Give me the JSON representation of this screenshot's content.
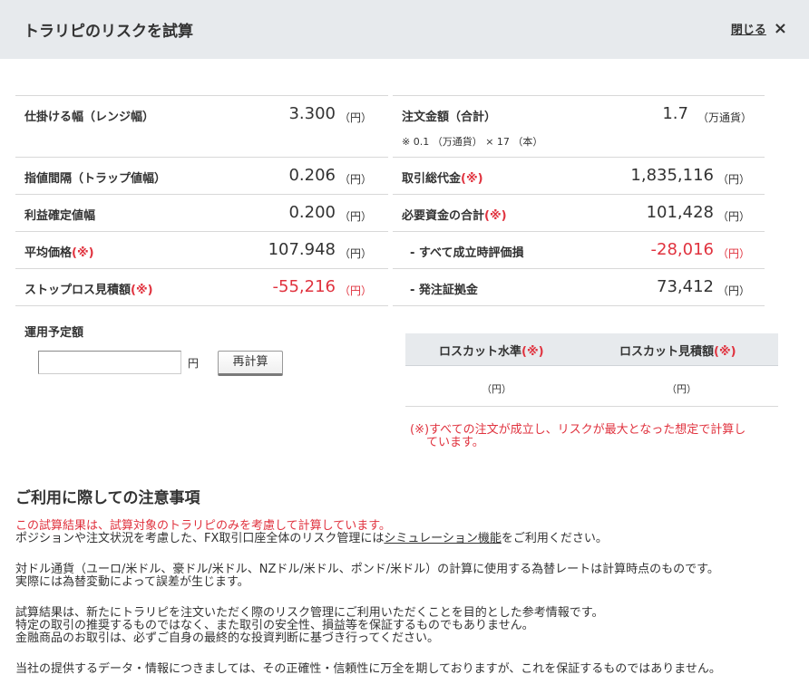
{
  "header": {
    "title": "トラリピのリスクを試算",
    "close_label": "閉じる",
    "close_icon": "×"
  },
  "left_rows": [
    {
      "label": "仕掛ける幅（レンジ幅）",
      "value": "3.300",
      "unit": "（円）"
    },
    {
      "label": "指値間隔（トラップ値幅）",
      "value": "0.206",
      "unit": "（円）"
    },
    {
      "label": "利益確定値幅",
      "value": "0.200",
      "unit": "（円）"
    },
    {
      "label": "平均価格",
      "mark": "(※)",
      "value": "107.948",
      "unit": "（円）"
    },
    {
      "label": "ストップロス見積額",
      "mark": "(※)",
      "value": "-55,216",
      "unit": "（円）"
    }
  ],
  "right_rows": [
    {
      "label": "注文金額（合計）",
      "value": "1.7",
      "unit": "（万通貨）",
      "sub": "※ 0.1 （万通貨） × 17 （本）"
    },
    {
      "label": "取引総代金",
      "mark": "(※)",
      "value": "1,835,116",
      "unit": "（円）"
    },
    {
      "label": "必要資金の合計",
      "mark": "(※)",
      "value": "101,428",
      "unit": "（円）"
    },
    {
      "label": "- すべて成立時評価損",
      "value": "-28,016",
      "unit": "（円）"
    },
    {
      "label": "- 発注証拠金",
      "value": "73,412",
      "unit": "（円）"
    }
  ],
  "plan": {
    "label": "運用予定額",
    "input_value": "",
    "unit": "円",
    "button": "再計算"
  },
  "losscut": {
    "col1": "ロスカット水準",
    "col2": "ロスカット見積額",
    "mark": "(※)",
    "unit1": "（円）",
    "unit2": "（円）"
  },
  "risk_note": {
    "line1": "(※)すべての注文が成立し、リスクが最大となった想定で計算し",
    "line2": "ています。"
  },
  "notes": {
    "title": "ご利用に際しての注意事項",
    "red_line": "この試算結果は、試算対象のトラリピのみを考慮して計算しています。",
    "p1_before": "ポジションや注文状況を考慮した、FX取引口座全体のリスク管理には",
    "p1_link": "シミュレーション機能",
    "p1_after": "をご利用ください。",
    "p2_l1": "対ドル通貨（ユーロ/米ドル、豪ドル/米ドル、NZドル/米ドル、ポンド/米ドル）の計算に使用する為替レートは計算時点のものです。",
    "p2_l2": "実際には為替変動によって誤差が生じます。",
    "p3_l1": "試算結果は、新たにトラリピを注文いただく際のリスク管理にご利用いただくことを目的とした参考情報です。",
    "p3_l2": "特定の取引の推奨するものではなく、また取引の安全性、損益等を保証するものでもありません。",
    "p3_l3": "金融商品のお取引は、必ずご自身の最終的な投資判断に基づき行ってください。",
    "p4_l1": "当社の提供するデータ・情報につきましては、その正確性・信頼性に万全を期しておりますが、これを保証するものではありません。"
  },
  "colors": {
    "accent_red": "#e0323e",
    "header_bg": "#e7eaed"
  }
}
